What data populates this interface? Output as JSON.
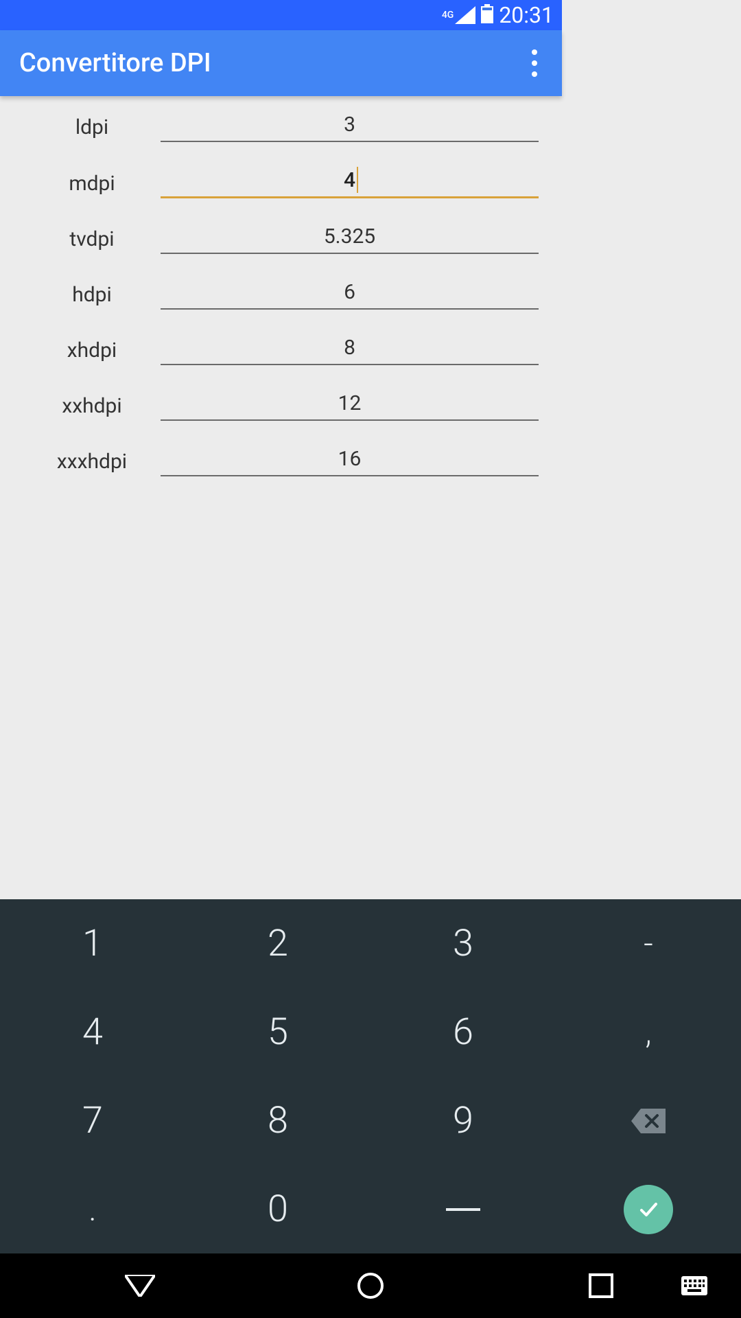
{
  "status": {
    "network_type": "4G",
    "time": "20:31"
  },
  "app": {
    "title": "Convertitore DPI"
  },
  "fields": [
    {
      "label": "ldpi",
      "value": "3",
      "active": false
    },
    {
      "label": "mdpi",
      "value": "4",
      "active": true
    },
    {
      "label": "tvdpi",
      "value": "5.325",
      "active": false
    },
    {
      "label": "hdpi",
      "value": "6",
      "active": false
    },
    {
      "label": "xhdpi",
      "value": "8",
      "active": false
    },
    {
      "label": "xxhdpi",
      "value": "12",
      "active": false
    },
    {
      "label": "xxxhdpi",
      "value": "16",
      "active": false
    }
  ],
  "keypad": {
    "rows": [
      [
        "1",
        "2",
        "3",
        "-"
      ],
      [
        "4",
        "5",
        "6",
        ","
      ],
      [
        "7",
        "8",
        "9",
        "backspace"
      ],
      [
        ".",
        "0",
        "underscore",
        "enter"
      ]
    ]
  }
}
